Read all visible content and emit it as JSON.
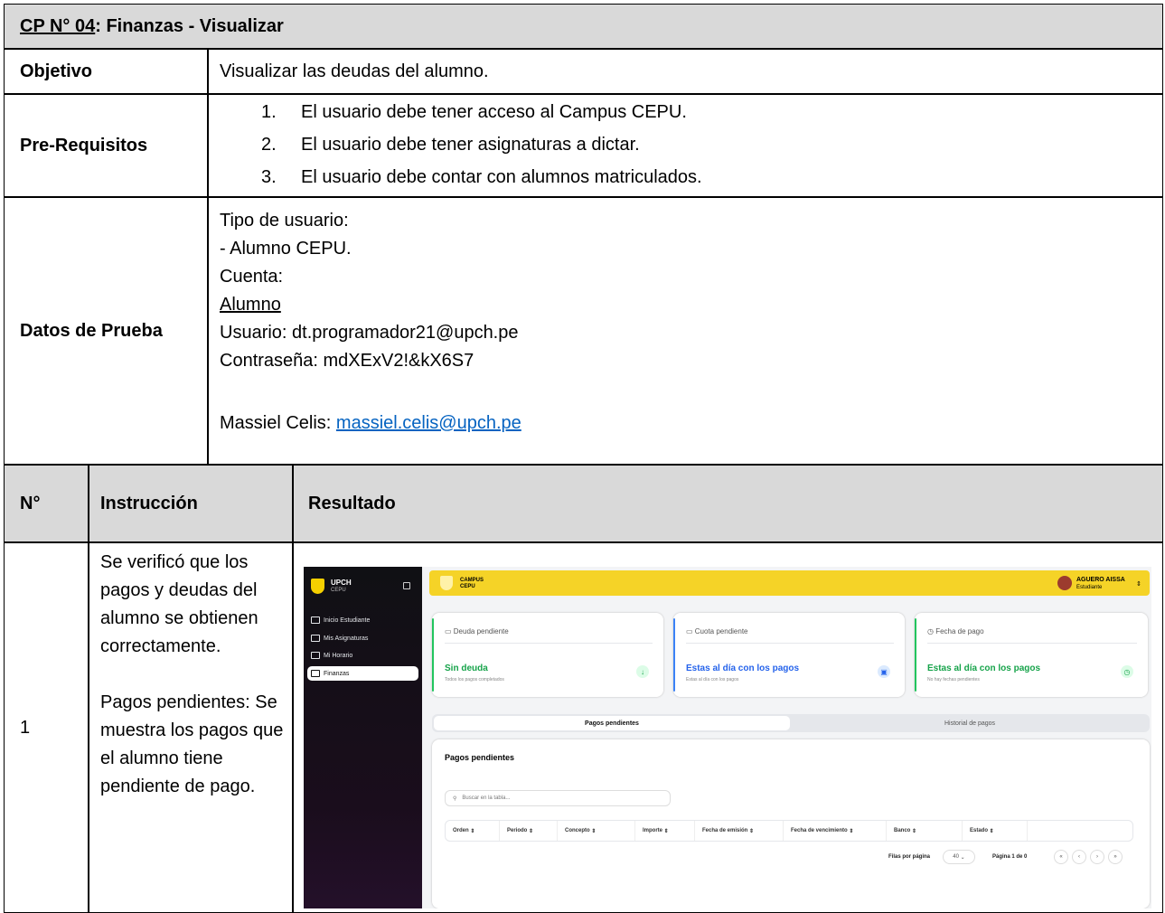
{
  "header": {
    "case_id": "CP N° 04",
    "case_title": ": Finanzas - Visualizar"
  },
  "objetivo": {
    "label": "Objetivo",
    "value": "Visualizar las deudas del alumno."
  },
  "prerequisitos": {
    "label": "Pre-Requisitos",
    "items": [
      {
        "num": "1.",
        "text": "El usuario debe tener acceso al Campus CEPU."
      },
      {
        "num": "2.",
        "text": "El usuario debe tener asignaturas a dictar."
      },
      {
        "num": "3.",
        "text": "El usuario debe contar con alumnos matriculados."
      }
    ]
  },
  "datos_prueba": {
    "label": "Datos de Prueba",
    "tipo_label": "Tipo de usuario:",
    "tipo_value": "- Alumno CEPU.",
    "cuenta_label": "Cuenta:",
    "cuenta_value": "Alumno",
    "usuario": "Usuario: dt.programador21@upch.pe",
    "contrasena": "Contraseña: mdXExV2!&kX6S7",
    "contact_prefix": "Massiel Celis: ",
    "contact_email": "massiel.celis@upch.pe"
  },
  "steps_header": {
    "num": "N°",
    "instruccion": "Instrucción",
    "resultado": "Resultado"
  },
  "step": {
    "num": "1",
    "instruccion_1": "Se verificó que los pagos y deudas del alumno se obtienen correctamente.",
    "instruccion_2": "Pagos pendientes: Se muestra los pagos que el alumno tiene pendiente de pago."
  },
  "screenshot": {
    "sidebar": {
      "brand": "UPCH",
      "brand_sub": "CEPU",
      "items": [
        {
          "label": "Inicio Estudiante",
          "icon": "folder-icon"
        },
        {
          "label": "Mis Asignaturas",
          "icon": "folder-icon"
        },
        {
          "label": "Mi Horario",
          "icon": "folder-icon"
        },
        {
          "label": "Finanzas",
          "icon": "folder-icon",
          "active": true
        }
      ]
    },
    "topbar": {
      "campus": "CAMPUS",
      "campus_sub": "CEPU",
      "user_name": "AGUERO AISSA",
      "user_role": "Estudiante"
    },
    "cards": [
      {
        "title": "Deuda pendiente",
        "value": "Sin deuda",
        "sub": "Todos los pagos completados",
        "color": "#22c55e",
        "icon": "arrow-down-icon"
      },
      {
        "title": "Cuota pendiente",
        "value": "Estas al día con los pagos",
        "sub": "Estas al día con los pagos",
        "color": "#3b82f6",
        "icon": "calendar-icon"
      },
      {
        "title": "Fecha de pago",
        "value": "Estas al día con los pagos",
        "sub": "No hay fechas pendientes",
        "color": "#22c55e",
        "icon": "clock-icon"
      }
    ],
    "tabs": [
      "Pagos pendientes",
      "Historial de pagos"
    ],
    "panel_title": "Pagos pendientes",
    "search_placeholder": "Buscar en la tabla...",
    "columns": [
      "Orden",
      "Periodo",
      "Concepto",
      "Importe",
      "Fecha de emisión",
      "Fecha de vencimiento",
      "Banco",
      "Estado"
    ],
    "rows_per_page_label": "Filas por página",
    "rows_per_page_value": "40",
    "page_label": "Página 1 de 0",
    "pager_buttons": [
      "«",
      "‹",
      "›",
      "»"
    ]
  }
}
